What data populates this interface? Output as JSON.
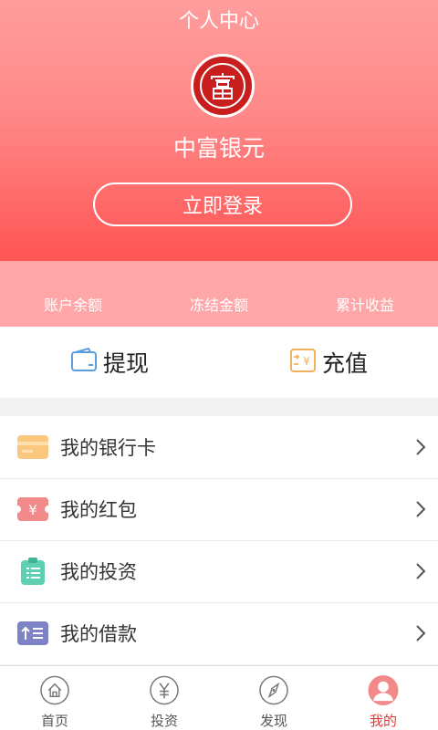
{
  "header": {
    "title": "个人中心",
    "brand": "中富银元",
    "login_label": "立即登录"
  },
  "stats": [
    {
      "label": "账户余额"
    },
    {
      "label": "冻结金额"
    },
    {
      "label": "累计收益"
    }
  ],
  "actions": [
    {
      "label": "提现",
      "icon": "wallet-icon"
    },
    {
      "label": "充值",
      "icon": "recharge-icon"
    }
  ],
  "menu": [
    {
      "label": "我的银行卡",
      "icon": "bank-card-icon",
      "color": "#f9c77d"
    },
    {
      "label": "我的红包",
      "icon": "red-packet-icon",
      "color": "#f28a8a"
    },
    {
      "label": "我的投资",
      "icon": "clipboard-icon",
      "color": "#5fcfb4"
    },
    {
      "label": "我的借款",
      "icon": "loan-icon",
      "color": "#7d83c4"
    }
  ],
  "tabs": [
    {
      "label": "首页",
      "icon": "home-icon",
      "active": false
    },
    {
      "label": "投资",
      "icon": "yen-icon",
      "active": false
    },
    {
      "label": "发现",
      "icon": "compass-icon",
      "active": false
    },
    {
      "label": "我的",
      "icon": "user-icon",
      "active": true
    }
  ],
  "colors": {
    "accent": "#e23a3a",
    "header_top": "#ff9d9d",
    "header_bottom": "#ff5454",
    "stats_bg": "#ffa7a8"
  }
}
